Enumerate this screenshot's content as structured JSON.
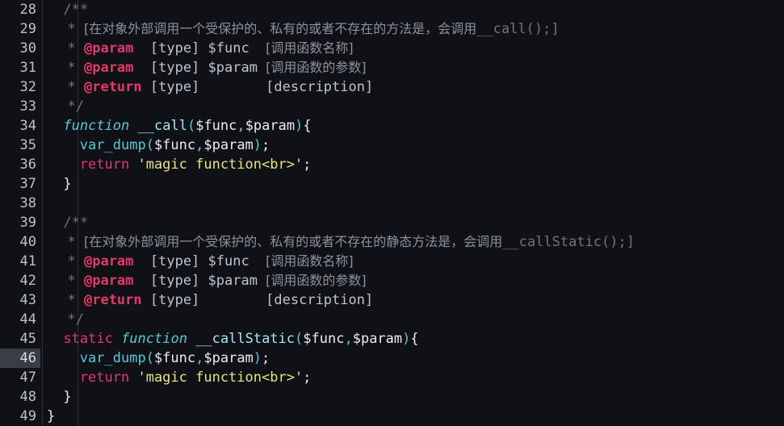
{
  "editor": {
    "name": "code-editor",
    "language": "php",
    "theme": "dark-plus-variant",
    "background_color": "#101116",
    "gutter_color": "#bcc2cd",
    "current_line": 46,
    "current_line_highlight_color": "#3a3d46",
    "first_visible_line": 28,
    "last_visible_line": 49,
    "colors": {
      "comment": "#6f7482",
      "doc_tag": "#e5396a",
      "doc_text": "#bfc4ce",
      "cjk_comment": "#8b919e",
      "keyword": "#e5396a",
      "function_keyword": "#56c8d8",
      "method_name": "#a5e8f0",
      "builtin_function": "#56c8d8",
      "variable": "#e9edf2",
      "string": "#e8e380",
      "punctuation": "#56c8d8",
      "brace": "#e9edf2"
    }
  },
  "lines": [
    {
      "number": "28",
      "indent": 4,
      "tokens": [
        {
          "text": "/**",
          "cls": "t-comment"
        }
      ]
    },
    {
      "number": "29",
      "indent": 5,
      "tokens": [
        {
          "text": "* ",
          "cls": "t-comment"
        },
        {
          "text": "[在对象外部调用一个受保护的、私有的或者不存在的方法是，会调用",
          "cls": "t-cjk"
        },
        {
          "text": "__call();]",
          "cls": "t-comment"
        }
      ]
    },
    {
      "number": "30",
      "indent": 5,
      "tokens": [
        {
          "text": "* ",
          "cls": "t-comment"
        },
        {
          "text": "@param",
          "cls": "t-doctag"
        },
        {
          "text": "  [type] $func  ",
          "cls": "t-doctext"
        },
        {
          "text": "[调用函数名称]",
          "cls": "t-cjk"
        }
      ]
    },
    {
      "number": "31",
      "indent": 5,
      "tokens": [
        {
          "text": "* ",
          "cls": "t-comment"
        },
        {
          "text": "@param",
          "cls": "t-doctag"
        },
        {
          "text": "  [type] $param ",
          "cls": "t-doctext"
        },
        {
          "text": "[调用函数的参数]",
          "cls": "t-cjk"
        }
      ]
    },
    {
      "number": "32",
      "indent": 5,
      "tokens": [
        {
          "text": "* ",
          "cls": "t-comment"
        },
        {
          "text": "@return",
          "cls": "t-doctag"
        },
        {
          "text": " [type]        [description]",
          "cls": "t-doctext"
        }
      ]
    },
    {
      "number": "33",
      "indent": 5,
      "tokens": [
        {
          "text": "*/",
          "cls": "t-comment"
        }
      ]
    },
    {
      "number": "34",
      "indent": 4,
      "tokens": [
        {
          "text": "function",
          "cls": "t-func-kw"
        },
        {
          "text": " ",
          "cls": "t-plain"
        },
        {
          "text": "__call",
          "cls": "t-method"
        },
        {
          "text": "(",
          "cls": "t-punct"
        },
        {
          "text": "$func",
          "cls": "t-var"
        },
        {
          "text": ",",
          "cls": "t-punct"
        },
        {
          "text": "$param",
          "cls": "t-var"
        },
        {
          "text": ")",
          "cls": "t-punct"
        },
        {
          "text": "{",
          "cls": "t-brace"
        }
      ]
    },
    {
      "number": "35",
      "indent": 8,
      "tokens": [
        {
          "text": "var_dump",
          "cls": "t-fn"
        },
        {
          "text": "(",
          "cls": "t-punct"
        },
        {
          "text": "$func",
          "cls": "t-var"
        },
        {
          "text": ",",
          "cls": "t-punct"
        },
        {
          "text": "$param",
          "cls": "t-var"
        },
        {
          "text": ")",
          "cls": "t-punct"
        },
        {
          "text": ";",
          "cls": "t-brace"
        }
      ]
    },
    {
      "number": "36",
      "indent": 8,
      "tokens": [
        {
          "text": "return",
          "cls": "t-keyword"
        },
        {
          "text": " ",
          "cls": "t-plain"
        },
        {
          "text": "'magic function<br>'",
          "cls": "t-string"
        },
        {
          "text": ";",
          "cls": "t-brace"
        }
      ]
    },
    {
      "number": "37",
      "indent": 4,
      "tokens": [
        {
          "text": "}",
          "cls": "t-brace"
        }
      ]
    },
    {
      "number": "38",
      "indent": 0,
      "tokens": []
    },
    {
      "number": "39",
      "indent": 4,
      "tokens": [
        {
          "text": "/**",
          "cls": "t-comment"
        }
      ]
    },
    {
      "number": "40",
      "indent": 5,
      "tokens": [
        {
          "text": "* ",
          "cls": "t-comment"
        },
        {
          "text": "[在对象外部调用一个受保护的、私有的或者不存在的静态方法是，会调用",
          "cls": "t-cjk"
        },
        {
          "text": "__callStatic();]",
          "cls": "t-comment"
        }
      ]
    },
    {
      "number": "41",
      "indent": 5,
      "tokens": [
        {
          "text": "* ",
          "cls": "t-comment"
        },
        {
          "text": "@param",
          "cls": "t-doctag"
        },
        {
          "text": "  [type] $func  ",
          "cls": "t-doctext"
        },
        {
          "text": "[调用函数名称]",
          "cls": "t-cjk"
        }
      ]
    },
    {
      "number": "42",
      "indent": 5,
      "tokens": [
        {
          "text": "* ",
          "cls": "t-comment"
        },
        {
          "text": "@param",
          "cls": "t-doctag"
        },
        {
          "text": "  [type] $param ",
          "cls": "t-doctext"
        },
        {
          "text": "[调用函数的参数]",
          "cls": "t-cjk"
        }
      ]
    },
    {
      "number": "43",
      "indent": 5,
      "tokens": [
        {
          "text": "* ",
          "cls": "t-comment"
        },
        {
          "text": "@return",
          "cls": "t-doctag"
        },
        {
          "text": " [type]        [description]",
          "cls": "t-doctext"
        }
      ]
    },
    {
      "number": "44",
      "indent": 5,
      "tokens": [
        {
          "text": "*/",
          "cls": "t-comment"
        }
      ]
    },
    {
      "number": "45",
      "indent": 4,
      "tokens": [
        {
          "text": "static",
          "cls": "t-keyword"
        },
        {
          "text": " ",
          "cls": "t-plain"
        },
        {
          "text": "function",
          "cls": "t-func-kw"
        },
        {
          "text": " ",
          "cls": "t-plain"
        },
        {
          "text": "__callStatic",
          "cls": "t-method"
        },
        {
          "text": "(",
          "cls": "t-punct"
        },
        {
          "text": "$func",
          "cls": "t-var"
        },
        {
          "text": ",",
          "cls": "t-punct"
        },
        {
          "text": "$param",
          "cls": "t-var"
        },
        {
          "text": ")",
          "cls": "t-punct"
        },
        {
          "text": "{",
          "cls": "t-brace"
        }
      ]
    },
    {
      "number": "46",
      "indent": 8,
      "current": true,
      "tokens": [
        {
          "text": "var_dump",
          "cls": "t-fn"
        },
        {
          "text": "(",
          "cls": "t-punct"
        },
        {
          "text": "$func",
          "cls": "t-var"
        },
        {
          "text": ",",
          "cls": "t-punct"
        },
        {
          "text": "$param",
          "cls": "t-var"
        },
        {
          "text": ")",
          "cls": "t-punct"
        },
        {
          "text": ";",
          "cls": "t-brace"
        }
      ]
    },
    {
      "number": "47",
      "indent": 8,
      "tokens": [
        {
          "text": "return",
          "cls": "t-keyword"
        },
        {
          "text": " ",
          "cls": "t-plain"
        },
        {
          "text": "'magic function<br>'",
          "cls": "t-string"
        },
        {
          "text": ";",
          "cls": "t-brace"
        }
      ]
    },
    {
      "number": "48",
      "indent": 4,
      "tokens": [
        {
          "text": "}",
          "cls": "t-brace"
        }
      ]
    },
    {
      "number": "49",
      "indent": 0,
      "tokens": [
        {
          "text": "}",
          "cls": "t-brace"
        }
      ]
    }
  ]
}
